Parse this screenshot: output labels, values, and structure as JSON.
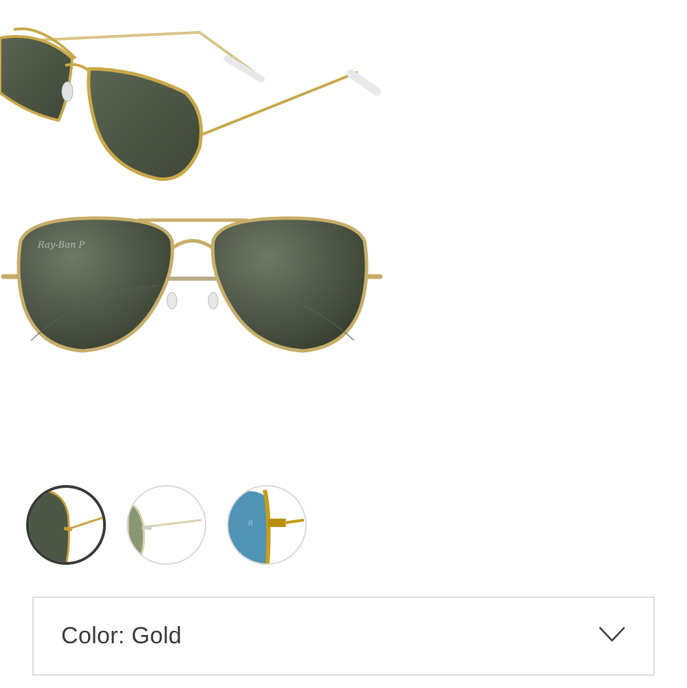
{
  "product": {
    "images": [
      {
        "name": "angle-view",
        "lens_color": "#4a5443",
        "frame_color": "#c9a84a"
      },
      {
        "name": "front-view",
        "lens_color": "#3f4839",
        "frame_color": "#c7ad6a"
      }
    ],
    "brand_mark": "Ray-Ban P"
  },
  "swatches": [
    {
      "name": "gold-green",
      "lens_color": "#4c5745",
      "frame_color": "#c9a03a",
      "selected": true
    },
    {
      "name": "silver-green",
      "lens_color": "#8a9775",
      "frame_color": "#cfcfc4",
      "selected": false
    },
    {
      "name": "gold-blue",
      "lens_color": "#4f93b5",
      "frame_color": "#c79d18",
      "selected": false
    }
  ],
  "color_select": {
    "label": "Color: Gold",
    "icon": "chevron-down-icon"
  }
}
